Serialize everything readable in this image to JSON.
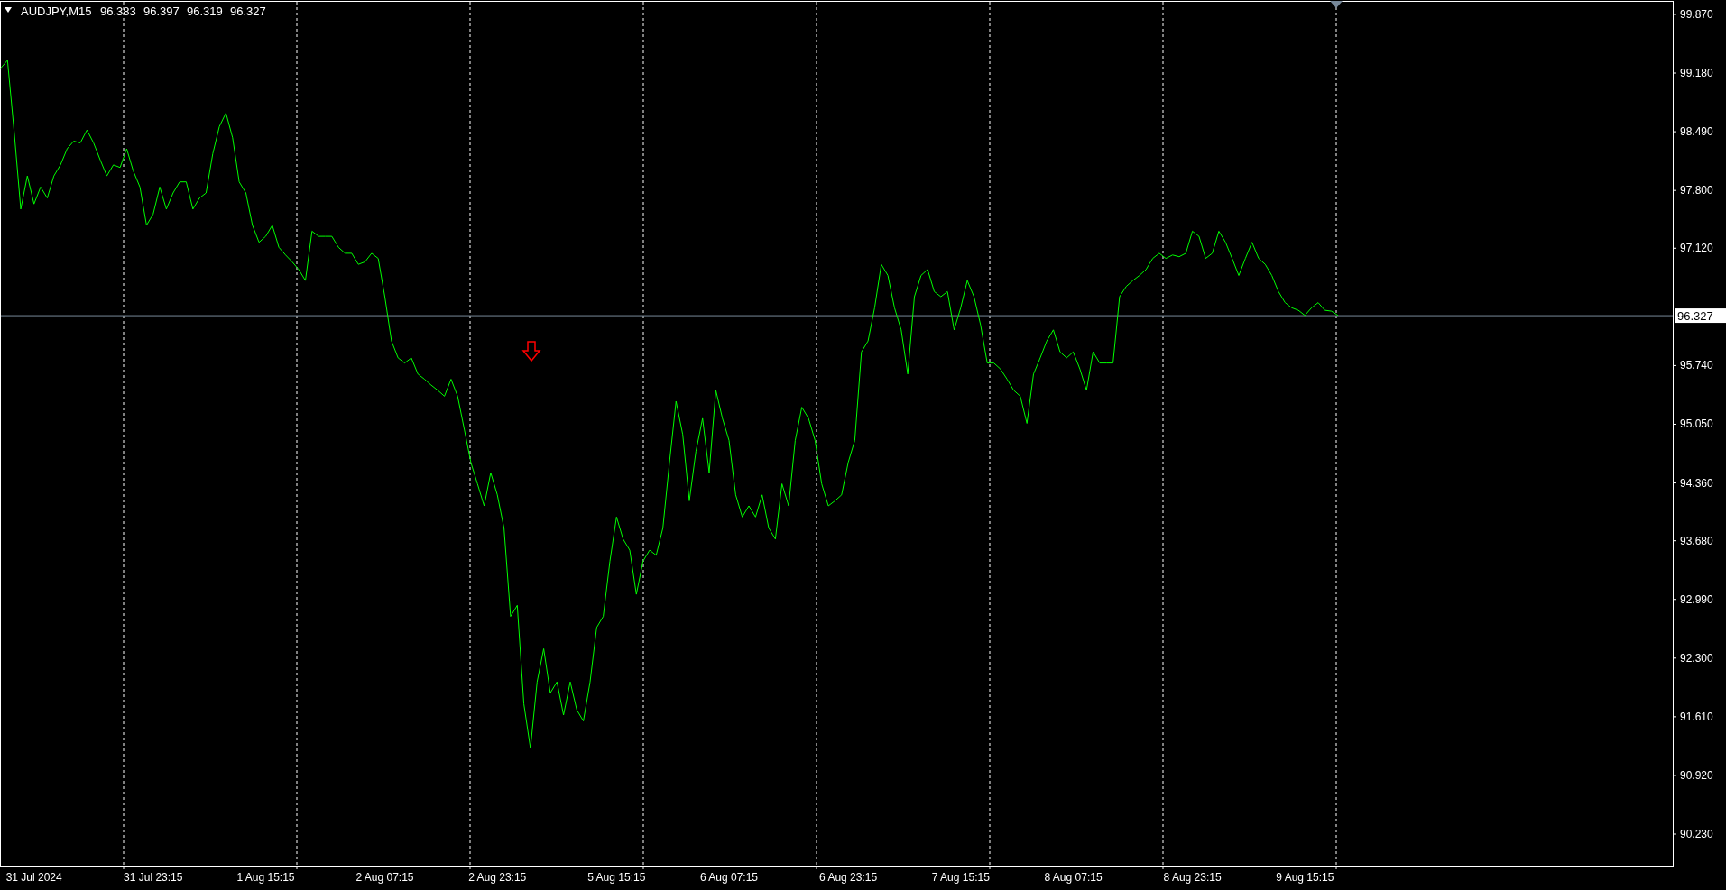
{
  "header": {
    "symbol": "AUDJPY,M15",
    "quotes": [
      "96.383",
      "96.397",
      "96.319",
      "96.327"
    ]
  },
  "objects": [
    {
      "kind": "arrow_down",
      "color": "#ff0000"
    }
  ],
  "chart_data": {
    "type": "line",
    "categories": [
      null,
      null,
      null,
      null,
      null,
      "31 Jul 2024",
      null,
      null,
      null,
      null,
      null,
      null,
      null,
      null,
      null,
      null,
      null,
      null,
      null,
      null,
      null,
      null,
      null,
      "31 Jul 23:15",
      null,
      null,
      null,
      null,
      null,
      null,
      null,
      null,
      null,
      null,
      null,
      null,
      null,
      null,
      null,
      null,
      "1 Aug 15:15",
      null,
      null,
      null,
      null,
      null,
      null,
      null,
      null,
      null,
      null,
      null,
      null,
      null,
      null,
      null,
      null,
      null,
      "2 Aug 07:15",
      null,
      null,
      null,
      null,
      null,
      null,
      null,
      null,
      null,
      null,
      null,
      null,
      null,
      null,
      null,
      null,
      "2 Aug 23:15",
      null,
      null,
      null,
      null,
      null,
      null,
      null,
      null,
      null,
      null,
      null,
      null,
      null,
      null,
      null,
      null,
      null,
      "5 Aug 15:15",
      null,
      null,
      null,
      null,
      null,
      null,
      null,
      null,
      null,
      null,
      null,
      null,
      null,
      null,
      null,
      null,
      "6 Aug 07:15",
      null,
      null,
      null,
      null,
      null,
      null,
      null,
      null,
      null,
      null,
      null,
      null,
      null,
      null,
      null,
      null,
      null,
      "6 Aug 23:15",
      null,
      null,
      null,
      null,
      null,
      null,
      null,
      null,
      null,
      null,
      null,
      null,
      null,
      null,
      null,
      null,
      "7 Aug 15:15",
      null,
      null,
      null,
      null,
      null,
      null,
      null,
      null,
      null,
      null,
      null,
      null,
      null,
      null,
      null,
      null,
      "8 Aug 07:15",
      null,
      null,
      null,
      null,
      null,
      null,
      null,
      null,
      null,
      null,
      null,
      null,
      null,
      null,
      null,
      null,
      null,
      "8 Aug 23:15",
      null,
      null,
      null,
      null,
      null,
      null,
      null,
      null,
      null,
      null,
      null,
      null,
      null,
      null,
      null,
      null,
      "9 Aug 15:15",
      null,
      null,
      null,
      null,
      null
    ],
    "ref_lines": [
      {
        "axis": "y",
        "value": 96.327,
        "label": "96.327",
        "color": "#778899"
      }
    ],
    "series": [
      {
        "color": "#00ff00",
        "values": [
          99.24,
          99.33,
          98.49,
          97.58,
          97.97,
          97.64,
          97.84,
          97.71,
          97.97,
          98.1,
          98.29,
          98.38,
          98.36,
          98.51,
          98.36,
          98.16,
          97.97,
          98.1,
          98.07,
          98.29,
          98.03,
          97.84,
          97.39,
          97.52,
          97.84,
          97.58,
          97.77,
          97.9,
          97.9,
          97.58,
          97.71,
          97.77,
          98.23,
          98.55,
          98.71,
          98.42,
          97.9,
          97.77,
          97.39,
          97.19,
          97.26,
          97.39,
          97.13,
          97.04,
          96.96,
          96.87,
          96.74,
          97.32,
          97.26,
          97.26,
          97.26,
          97.13,
          97.06,
          97.06,
          96.93,
          96.96,
          97.06,
          97.0,
          96.55,
          96.03,
          95.83,
          95.77,
          95.83,
          95.64,
          95.58,
          95.51,
          95.45,
          95.38,
          95.58,
          95.38,
          94.99,
          94.6,
          94.35,
          94.09,
          94.48,
          94.22,
          93.83,
          92.79,
          92.92,
          91.76,
          91.24,
          92.02,
          92.41,
          91.89,
          92.02,
          91.63,
          92.02,
          91.69,
          91.56,
          92.02,
          92.66,
          92.79,
          93.44,
          93.96,
          93.7,
          93.57,
          93.05,
          93.44,
          93.57,
          93.51,
          93.83,
          94.6,
          95.32,
          94.93,
          94.15,
          94.73,
          95.12,
          94.48,
          95.45,
          95.12,
          94.86,
          94.22,
          93.96,
          94.09,
          93.96,
          94.22,
          93.83,
          93.7,
          94.35,
          94.09,
          94.86,
          95.25,
          95.12,
          94.86,
          94.35,
          94.09,
          94.15,
          94.22,
          94.6,
          94.86,
          95.9,
          96.03,
          96.42,
          96.93,
          96.8,
          96.42,
          96.16,
          95.64,
          96.55,
          96.8,
          96.87,
          96.61,
          96.55,
          96.61,
          96.16,
          96.42,
          96.74,
          96.55,
          96.22,
          95.77,
          95.77,
          95.7,
          95.58,
          95.45,
          95.38,
          95.06,
          95.64,
          95.83,
          96.03,
          96.16,
          95.9,
          95.83,
          95.9,
          95.7,
          95.45,
          95.9,
          95.77,
          95.77,
          95.77,
          96.55,
          96.67,
          96.74,
          96.8,
          96.87,
          97.0,
          97.06,
          97.0,
          97.04,
          97.02,
          97.06,
          97.32,
          97.26,
          97.0,
          97.06,
          97.32,
          97.19,
          97.0,
          96.8,
          97.0,
          97.19,
          97.0,
          96.93,
          96.8,
          96.61,
          96.48,
          96.42,
          96.39,
          96.33,
          96.42,
          96.48,
          96.39,
          96.38,
          96.33
        ]
      }
    ],
    "ylim": [
      89.859,
      100.018
    ],
    "yticks": [
      {
        "value": 99.87,
        "label": "99.870"
      },
      {
        "value": 99.18,
        "label": "99.180"
      },
      {
        "value": 98.49,
        "label": "98.490"
      },
      {
        "value": 97.8,
        "label": "97.800"
      },
      {
        "value": 97.12,
        "label": "97.120"
      },
      {
        "value": 95.74,
        "label": "95.740"
      },
      {
        "value": 95.05,
        "label": "95.050"
      },
      {
        "value": 94.36,
        "label": "94.360"
      },
      {
        "value": 93.68,
        "label": "93.680"
      },
      {
        "value": 92.99,
        "label": "92.990"
      },
      {
        "value": 92.3,
        "label": "92.300"
      },
      {
        "value": 91.61,
        "label": "91.610"
      },
      {
        "value": 90.92,
        "label": "90.920"
      },
      {
        "value": 90.23,
        "label": "90.230"
      }
    ]
  }
}
